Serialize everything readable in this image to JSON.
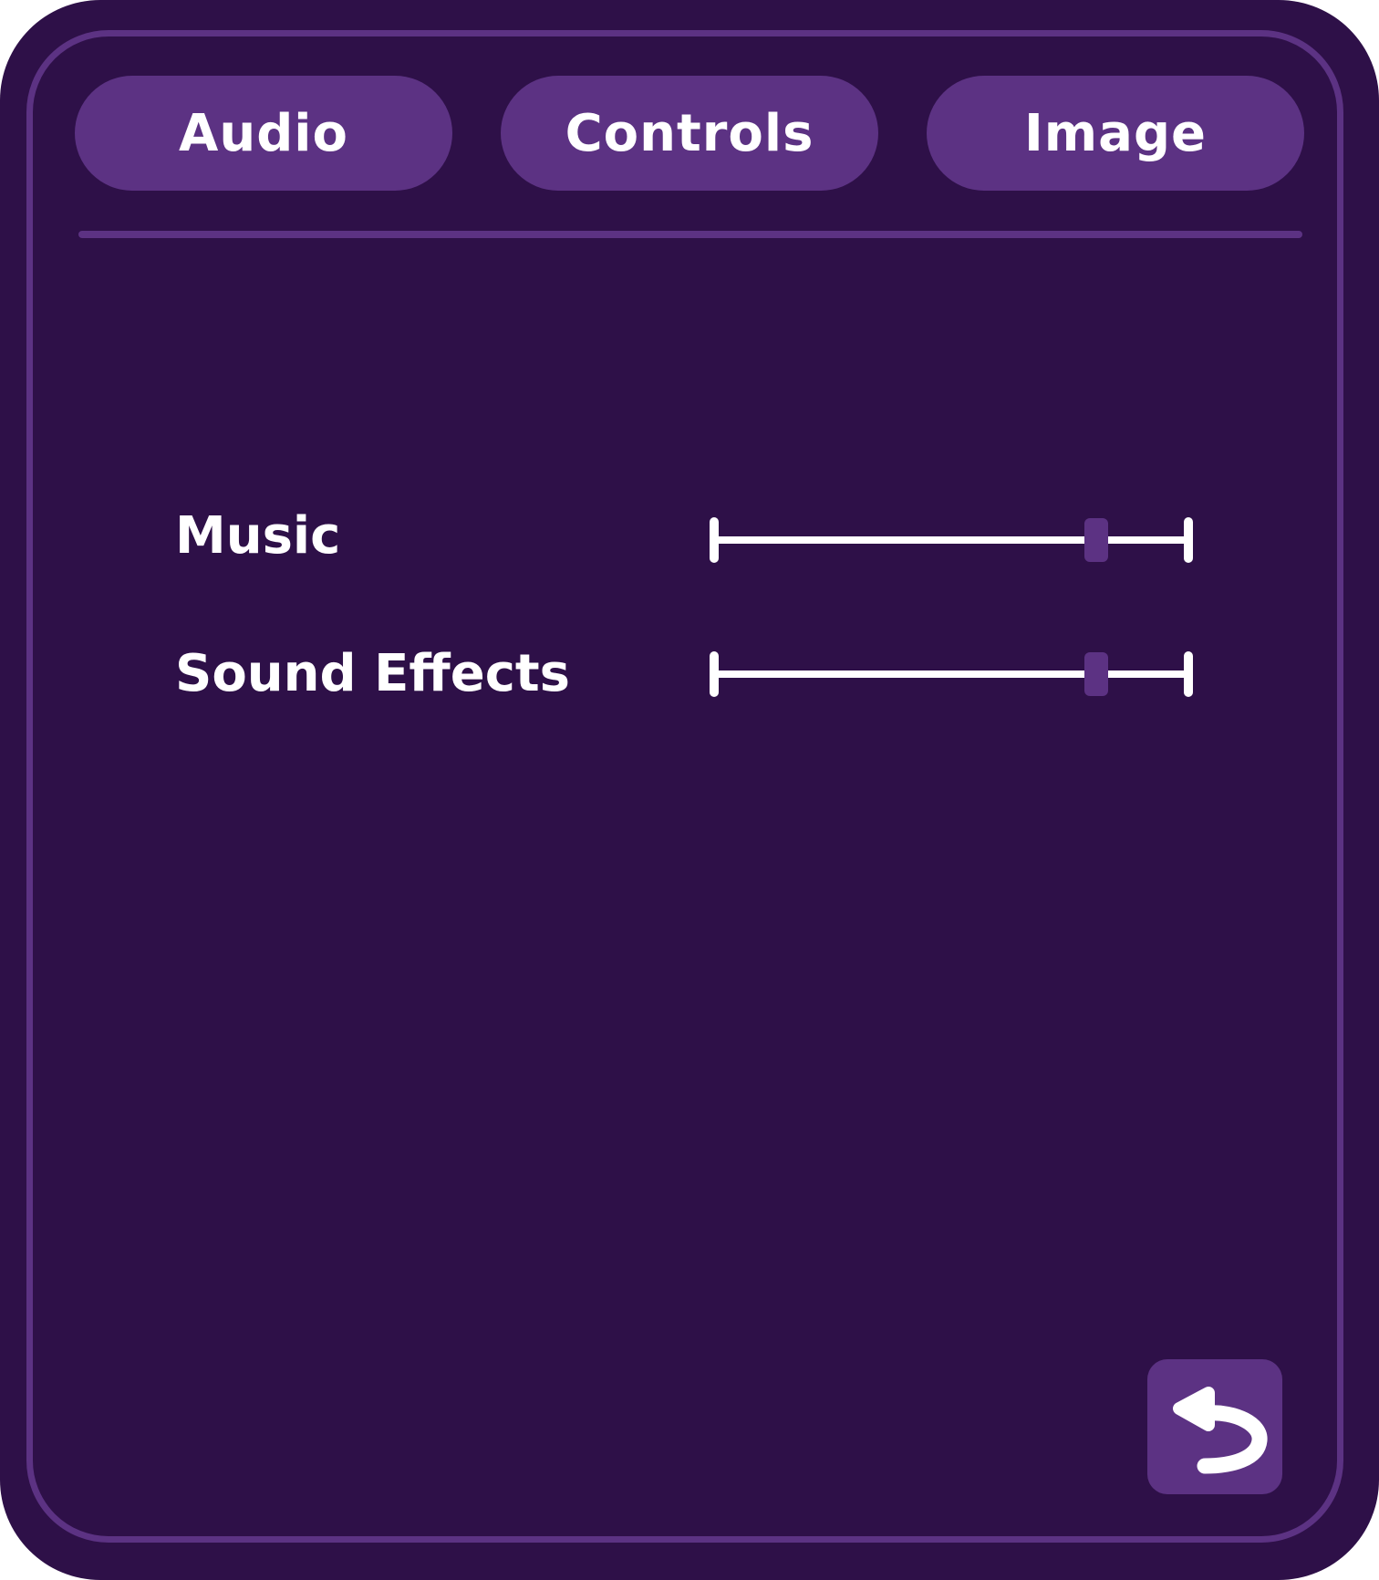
{
  "tabs": {
    "audio": "Audio",
    "controls": "Controls",
    "image": "Image"
  },
  "settings": {
    "music": {
      "label": "Music",
      "level": 0.8
    },
    "sound_effects": {
      "label": "Sound Effects",
      "level": 0.8
    }
  },
  "back_button": {
    "icon": "undo-arrow-icon"
  },
  "colors": {
    "background": "#2e1048",
    "accent": "#5c3283",
    "text": "#ffffff"
  }
}
